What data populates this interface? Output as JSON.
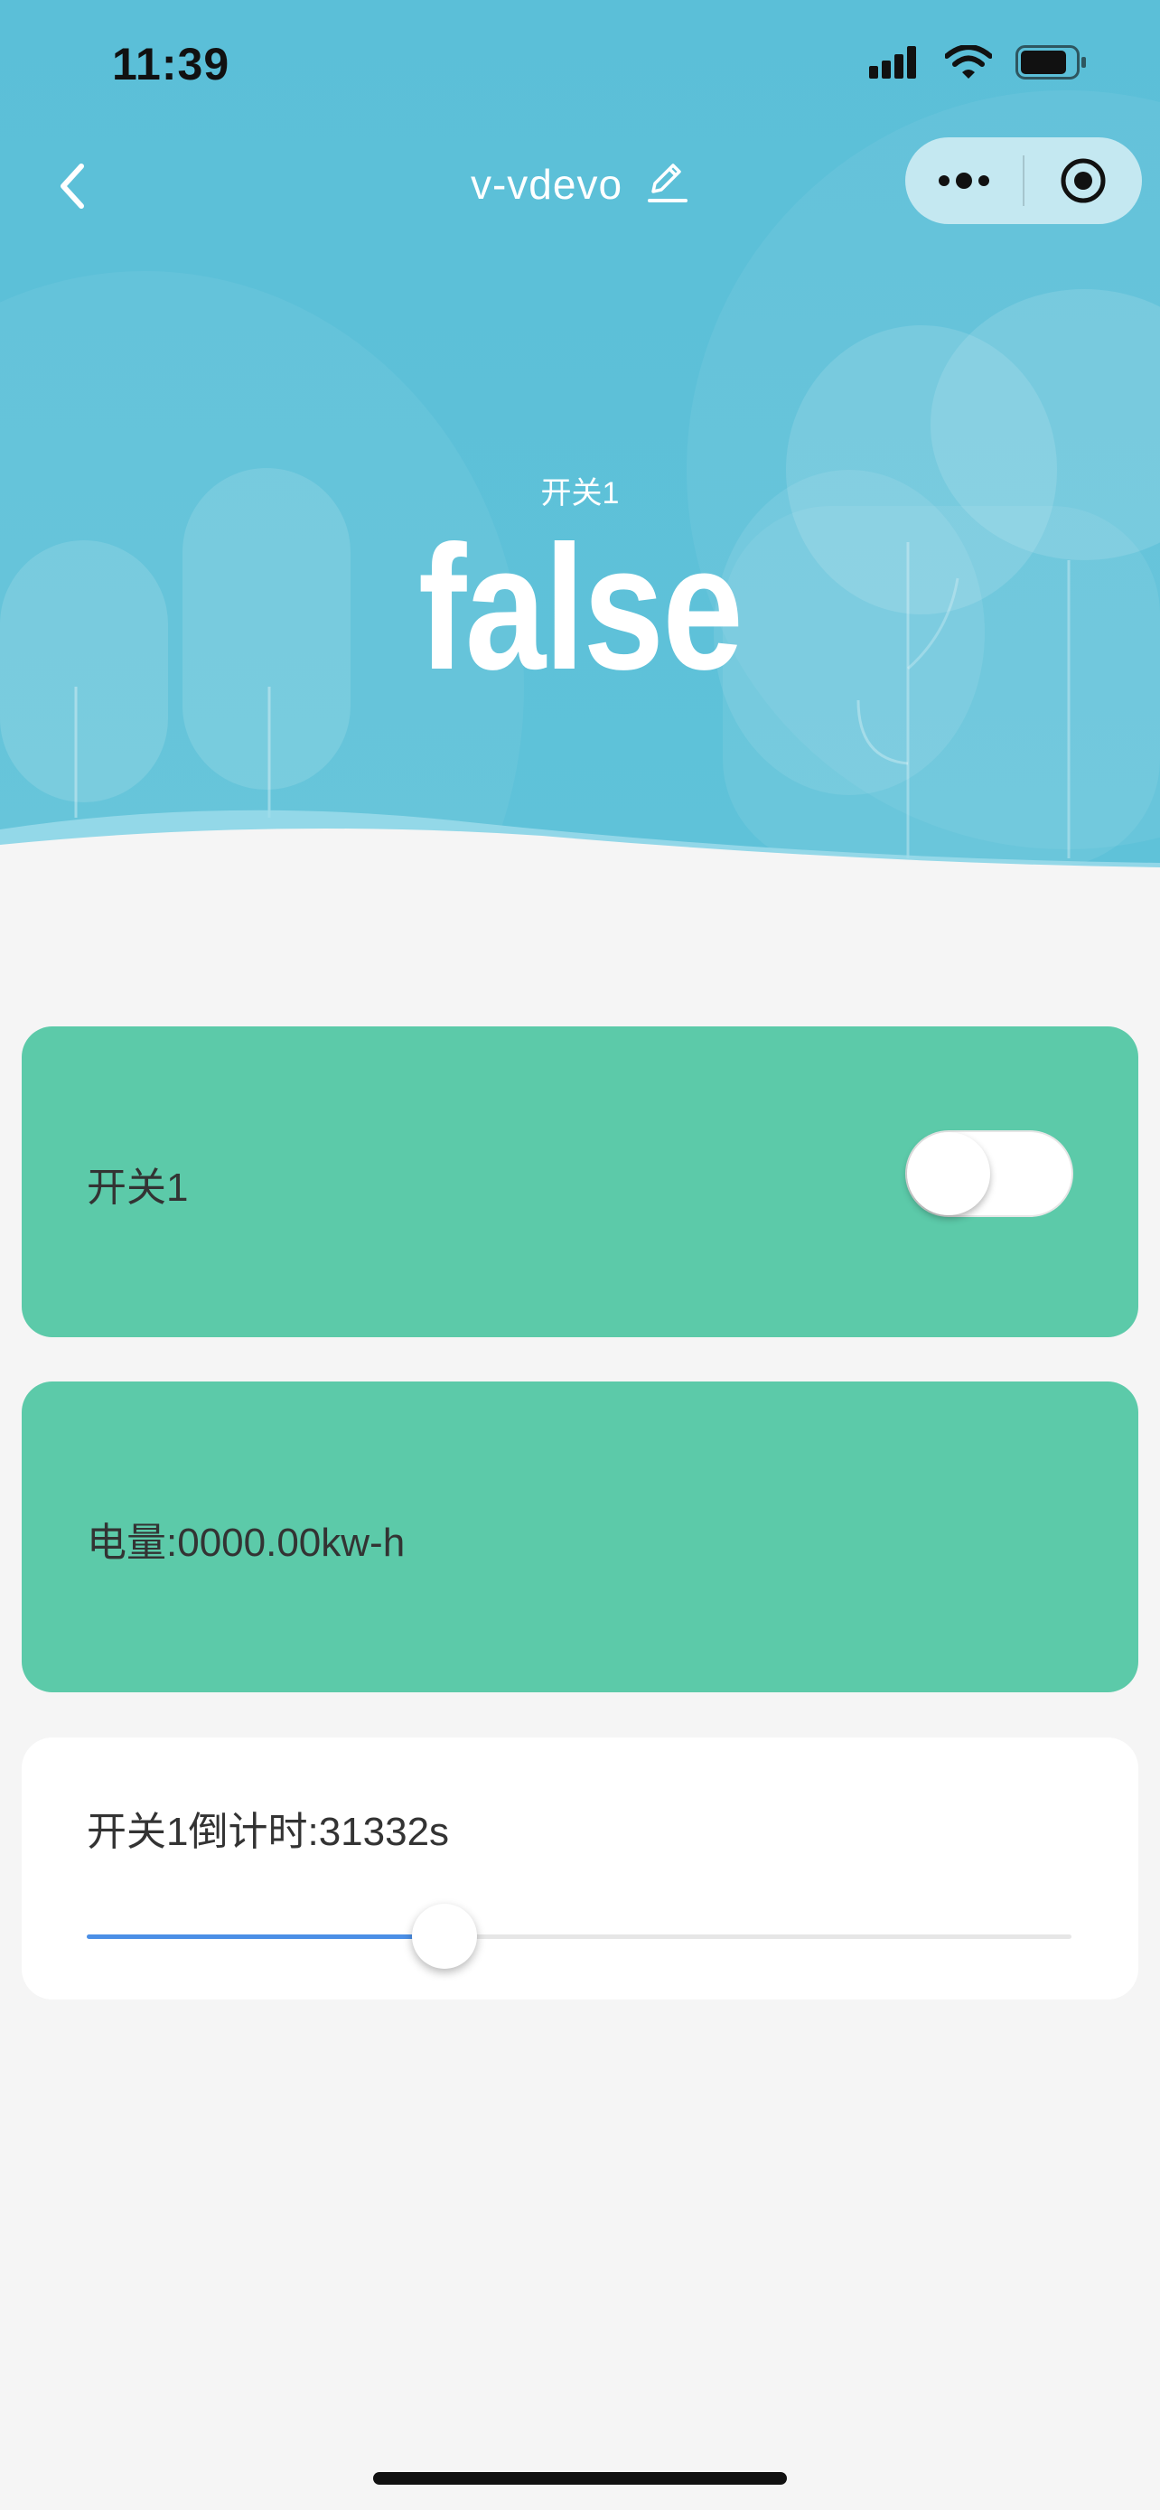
{
  "status_bar": {
    "time": "11:39",
    "icons": [
      "signal-icon",
      "wifi-icon",
      "battery-icon"
    ]
  },
  "nav": {
    "title": "v-vdevo",
    "back_icon": "chevron-left-icon",
    "edit_icon": "pencil-icon",
    "menu_icon": "more-dots-icon",
    "close_icon": "target-circle-icon"
  },
  "hero": {
    "label": "开关1",
    "value": "false"
  },
  "switch_card": {
    "label": "开关1",
    "toggle_on": false
  },
  "power_card": {
    "text": "电量:0000.00kw-h"
  },
  "countdown_card": {
    "text": "开关1倒计时:31332s",
    "slider_fraction": 0.363
  },
  "colors": {
    "hero_bg": "#5cbfd8",
    "card_green": "#5ccaa9",
    "slider_fill": "#4b8fe6",
    "page_bg": "#f5f5f5"
  }
}
